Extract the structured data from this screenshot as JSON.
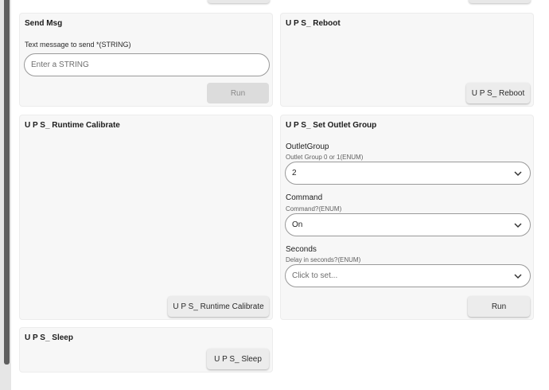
{
  "cards": {
    "send_msg": {
      "title": "Send Msg",
      "field_label": "Text message to send *(STRING)",
      "input_placeholder": "Enter a STRING",
      "run_label": "Run"
    },
    "reboot": {
      "title": "U P S_ Reboot",
      "button_label": "U P S_ Reboot"
    },
    "runtime_calibrate": {
      "title": "U P S_ Runtime Calibrate",
      "button_label": "U P S_ Runtime Calibrate"
    },
    "set_outlet_group": {
      "title": "U P S_ Set Outlet Group",
      "fields": [
        {
          "name": "OutletGroup",
          "hint": "Outlet Group 0 or 1(ENUM)",
          "value": "2"
        },
        {
          "name": "Command",
          "hint": "Command?(ENUM)",
          "value": "On"
        },
        {
          "name": "Seconds",
          "hint": "Delay in seconds?(ENUM)",
          "placeholder": "Click to set..."
        }
      ],
      "run_label": "Run"
    },
    "sleep": {
      "title": "U P S_ Sleep",
      "button_label": "U P S_ Sleep"
    }
  },
  "icons": {
    "select_arrow": "chevron-down-icon"
  }
}
